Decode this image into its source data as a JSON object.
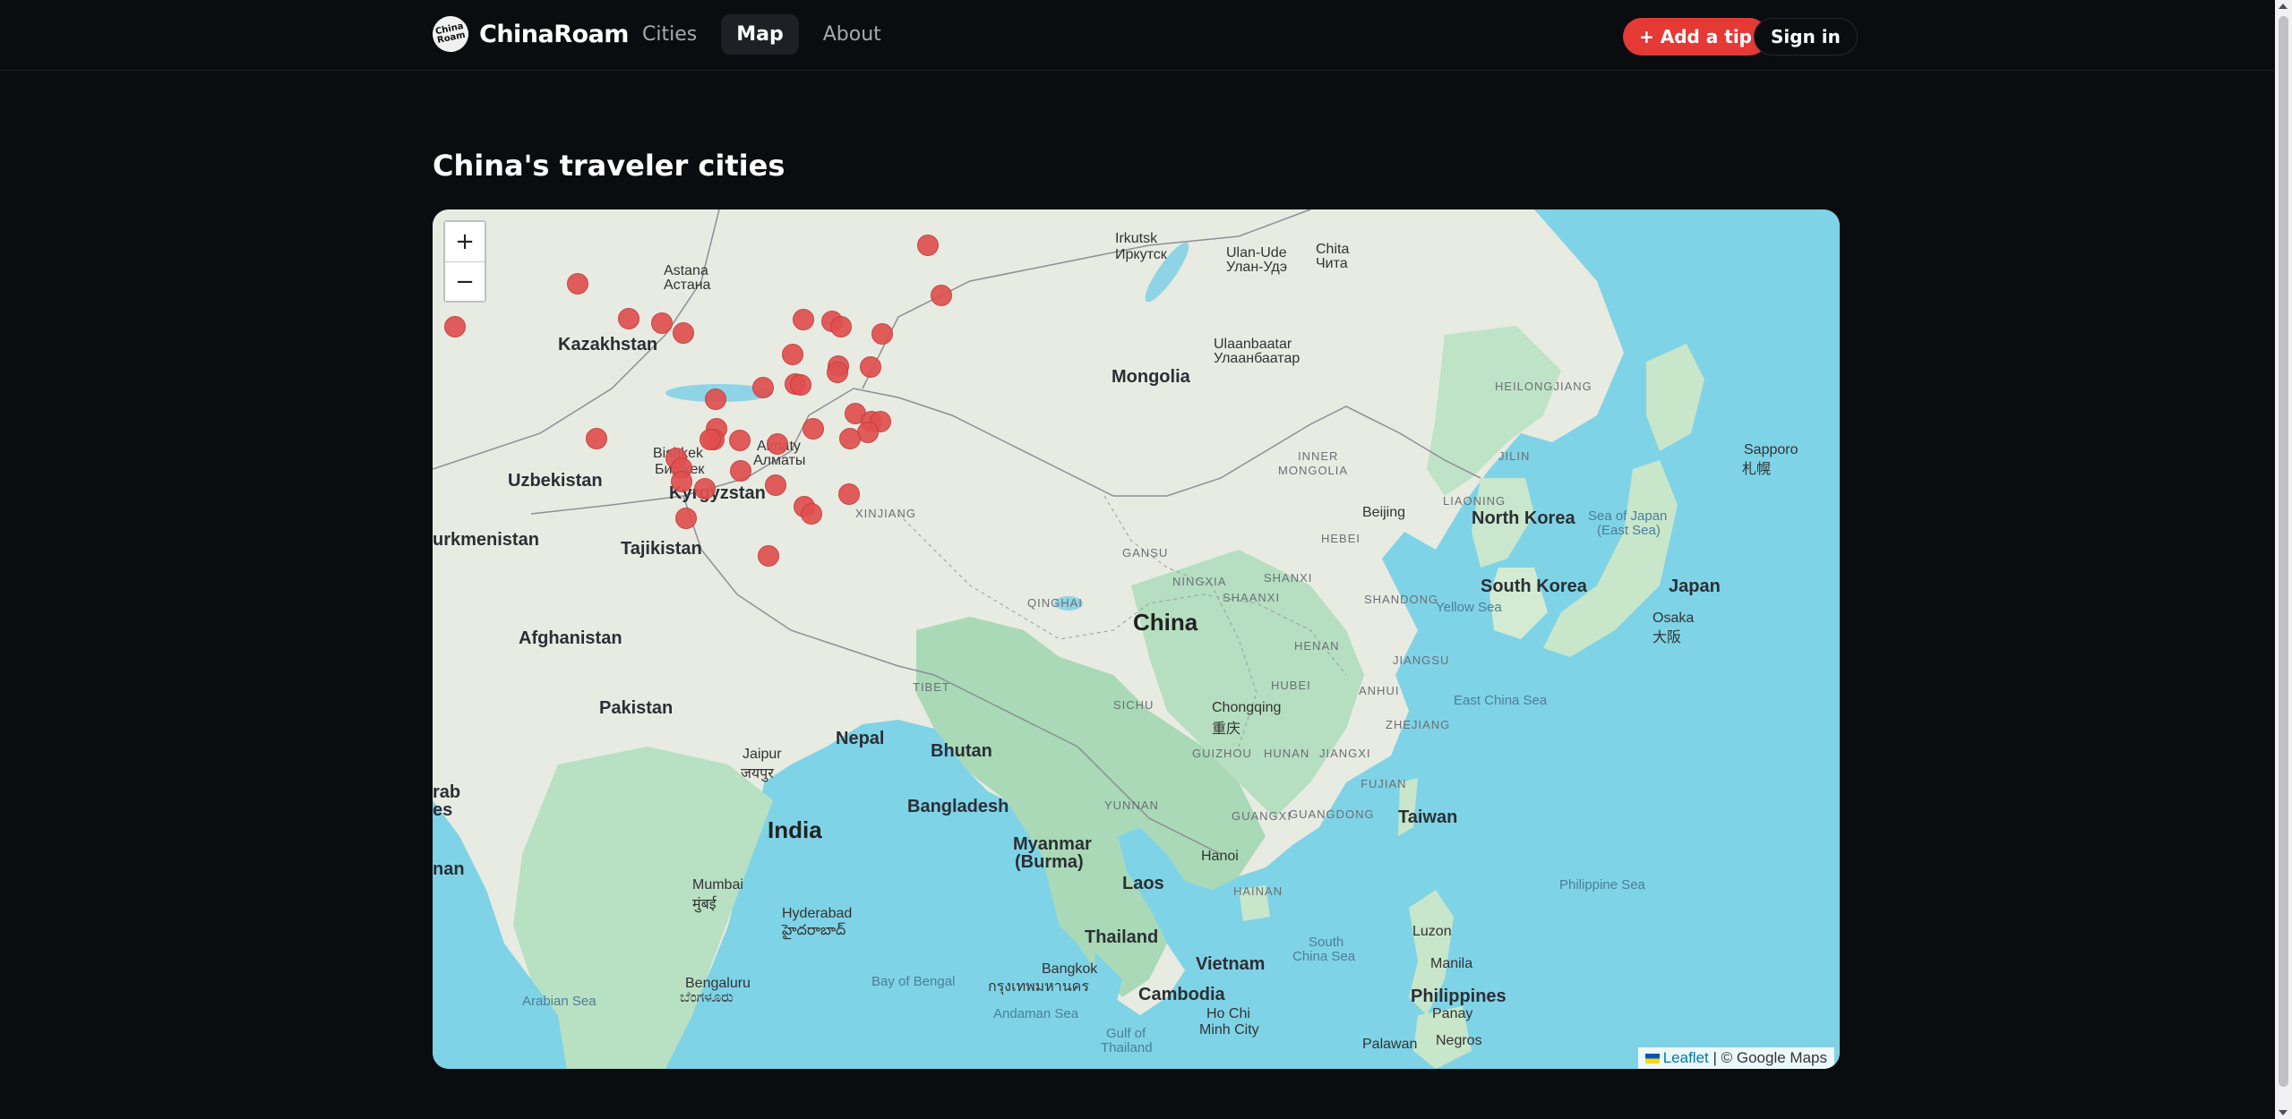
{
  "brand": {
    "logo_text": "China Roam",
    "name": "ChinaRoam"
  },
  "nav": {
    "items": [
      "Cities",
      "Map",
      "About"
    ],
    "active": "Map"
  },
  "actions": {
    "add_tip": "+ Add a tip",
    "sign_in": "Sign in"
  },
  "page": {
    "title": "China's traveler cities"
  },
  "map": {
    "zoom_in": "+",
    "zoom_out": "−",
    "attribution": {
      "leaflet": "Leaflet",
      "separator": " | ",
      "provider": "© Google Maps"
    },
    "labels": {
      "kazakhstan": "Kazakhstan",
      "astana": "Astana",
      "astana_native": "Астана",
      "mongolia": "Mongolia",
      "irkutsk": "Irkutsk",
      "irkutsk_native": "Иркутск",
      "ulan_ude": "Ulan-Ude",
      "ulan_ude_native": "Улан-Удэ",
      "chita": "Chita",
      "chita_native": "Чита",
      "ulaanbaatar": "Ulaanbaatar",
      "ulaanbaatar_native": "Улаанбаатар",
      "uzbekistan": "Uzbekistan",
      "kyrgyzstan": "Kyrgyzstan",
      "bishkek": "Bishkek",
      "bishkek_native": "Бишкек",
      "almaty": "Almaty",
      "almaty_native": "Алматы",
      "turkmenistan": "urkmenistan",
      "tajikistan": "Tajikistan",
      "afghanistan": "Afghanistan",
      "pakistan": "Pakistan",
      "xinjiang": "XINJIANG",
      "qinghai": "QINGHAI",
      "tibet": "TIBET",
      "gansu": "GANSU",
      "ningxia": "NINGXIA",
      "shaanxi": "SHAANXI",
      "shanxi": "SHANXI",
      "henan": "HENAN",
      "hubei": "HUBEI",
      "anhui": "ANHUI",
      "jiangsu": "JIANGSU",
      "zhejiang": "ZHEJIANG",
      "jiangxi": "JIANGXI",
      "hunan": "HUNAN",
      "guizhou": "GUIZHOU",
      "sichuan": "SICHU",
      "yunnan": "YUNNAN",
      "guangxi": "GUANGXI",
      "guangdong": "GUANGDONG",
      "fujian": "FUJIAN",
      "hainan": "HAINAN",
      "hebei": "HEBEI",
      "shandong": "SHANDONG",
      "inner_mongolia_1": "INNER",
      "inner_mongolia_2": "MONGOLIA",
      "liaoning": "LIAONING",
      "jilin": "JILIN",
      "heilongjiang": "HEILONGJIANG",
      "china": "China",
      "beijing": "Beijing",
      "chongqing": "Chongqing",
      "chongqing_native": "重庆",
      "nepal": "Nepal",
      "bhutan": "Bhutan",
      "bangladesh": "Bangladesh",
      "india": "India",
      "jaipur": "Jaipur",
      "jaipur_native": "जयपुर",
      "myanmar": "Myanmar",
      "myanmar_2": "(Burma)",
      "laos": "Laos",
      "hanoi": "Hanoi",
      "thailand": "Thailand",
      "bangkok": "Bangkok",
      "bangkok_native": "กรุงเทพมหานคร",
      "vietnam": "Vietnam",
      "cambodia": "Cambodia",
      "ho_chi_minh": "Ho Chi",
      "ho_chi_minh_2": "Minh City",
      "mumbai": "Mumbai",
      "mumbai_native": "मुंबई",
      "hyderabad": "Hyderabad",
      "hyderabad_native": "హైదరాబాద్",
      "bengaluru": "Bengaluru",
      "bengaluru_native": "ಬೆಂಗಳೂರು",
      "arabian_sea": "Arabian Sea",
      "bay_of_bengal": "Bay of Bengal",
      "andaman_sea": "Andaman Sea",
      "gulf_thailand_1": "Gulf of",
      "gulf_thailand_2": "Thailand",
      "south_china_sea_1": "South",
      "south_china_sea_2": "China Sea",
      "north_korea": "North Korea",
      "south_korea": "South Korea",
      "sea_of_japan_1": "Sea of Japan",
      "sea_of_japan_2": "(East Sea)",
      "japan": "Japan",
      "osaka": "Osaka",
      "osaka_native": "大阪",
      "sapporo": "Sapporo",
      "sapporo_native": "札幌",
      "yellow_sea": "Yellow Sea",
      "east_china_sea": "East China Sea",
      "taiwan": "Taiwan",
      "philippine_sea": "Philippine Sea",
      "philippines": "Philippines",
      "manila": "Manila",
      "luzon": "Luzon",
      "panay": "Panay",
      "negros": "Negros",
      "palawan": "Palawan",
      "arab_1": "rab",
      "arab_2": "es",
      "oman": "nan"
    }
  }
}
